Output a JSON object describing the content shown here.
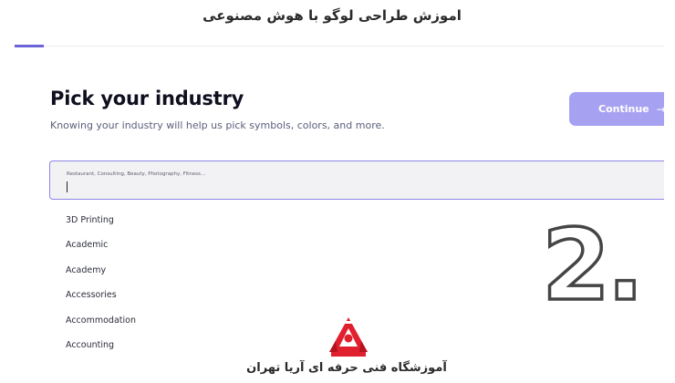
{
  "banner": {
    "title": "اموزش طراحی لوگو با هوش مصنوعی"
  },
  "header": {
    "progress": 0.045
  },
  "main": {
    "heading": "Pick your industry",
    "subheading": "Knowing your industry will help us pick symbols, colors, and more.",
    "continue_label": "Continue",
    "continue_icon": "arrow-right-icon",
    "search": {
      "placeholder": "Restaurant, Consulting, Beauty, Photography, Fitness...",
      "value": ""
    },
    "options": [
      "3D Printing",
      "Academic",
      "Academy",
      "Accessories",
      "Accommodation",
      "Accounting"
    ]
  },
  "overlay": {
    "step_number": "2.",
    "school_name": "آموزشگاه فنی حرفه ای آریا تهران",
    "logo_icon": "aria-academy-logo"
  },
  "colors": {
    "accent": "#6c63d9",
    "button": "#a7a1f1",
    "field_border": "#8d86e6",
    "logo_red": "#e0202f"
  }
}
